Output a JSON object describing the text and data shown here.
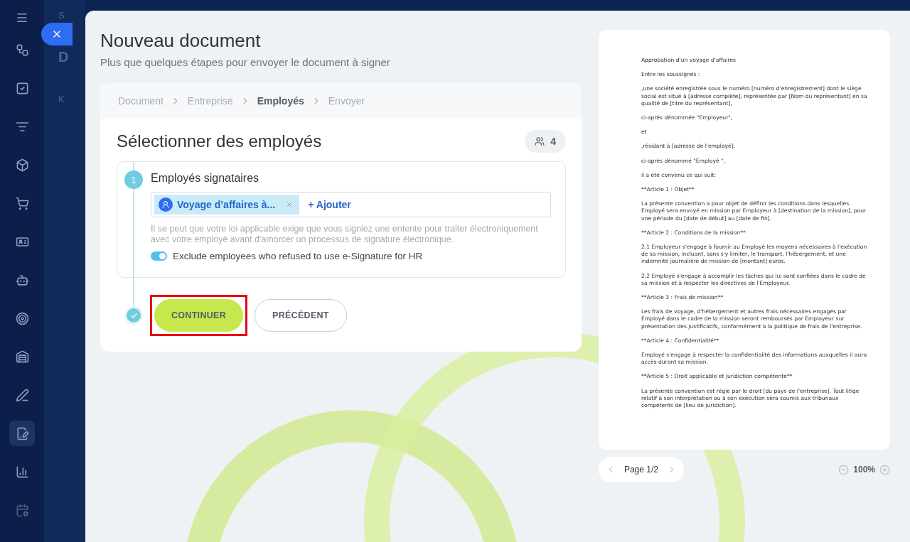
{
  "background": {
    "search_fragment": "S",
    "title_fragment": "D",
    "button_fragment": "K"
  },
  "modal": {
    "title": "Nouveau document",
    "subtitle": "Plus que quelques étapes pour envoyer le document à signer"
  },
  "breadcrumb": [
    {
      "label": "Document",
      "selected": false
    },
    {
      "label": "Entreprise",
      "selected": false
    },
    {
      "label": "Employés",
      "selected": true
    },
    {
      "label": "Envoyer",
      "selected": false
    }
  ],
  "section": {
    "title": "Sélectionner des employés",
    "count": "4"
  },
  "step": {
    "number": "1",
    "title": "Employés signataires",
    "tag": "Voyage d’affaires à...",
    "add_link": "+ Ajouter",
    "hint": "Il se peut que votre loi applicable exige que vous signiez une entente pour traiter électroniquement avec votre employé avant d'amorcer un processus de signature électronique.",
    "toggle": {
      "label": "Exclude employees who refused to use e-Signature for HR",
      "on": true
    }
  },
  "buttons": [
    {
      "label": "CONTINUER",
      "kind": "primary",
      "highlighted": true
    },
    {
      "label": "PRÉCÉDENT",
      "kind": "secondary",
      "highlighted": false
    }
  ],
  "document": {
    "paragraphs": [
      "Approbation d'un voyage d'affaires",
      "Entre les soussignés :",
      " ,une société enregistrée sous le numéro [numéro d'enregistrement] dont le siège social est situé à [adresse complète], représentée par [Nom du représentant] en sa qualité de [titre du représentant],",
      "ci-après dénommée \"Employeur\",",
      "et",
      " ,résidant à [adresse de l'employé],",
      "ci-après dénommé \"Employé \",",
      "il a été convenu ce qui suit:",
      "**Article 1 : Objet**",
      "La présente convention a pour objet de définir les conditions dans lesquelles Employé sera envoyé en mission par Employeur à [destination de la mission], pour une période du [date de début] au [date de fin].",
      "**Article 2 : Conditions de la mission**",
      "2.1 Employeur s'engage à fournir au Employé les moyens nécessaires à l'exécution de sa mission, incluant, sans s'y limiter, le transport, l'hébergement, et une indemnité journalière de mission de [montant] euros.",
      "2.2 Employé s'engage à accomplir les tâches qui lui sont confiées dans le cadre de sa mission et à respecter les directives de l'Employeur.",
      "**Article 3 : Frais de mission**",
      "Les frais de voyage, d'hébergement et autres frais nécessaires engagés par Employé dans le cadre de la mission seront remboursés par Employeur sur présentation des justificatifs, conformément à la politique de frais de l'entreprise.",
      "**Article 4 : Confidentialité**",
      "Employé s'engage à respecter la confidentialité des informations auxquelles il aura accès durant sa mission.",
      "**Article 5 : Droit applicable et juridiction compétente**",
      "La présente convention est régie par le droit [du pays de l'entreprise]. Tout litige relatif à son interprétation ou à son exécution sera soumis aux tribunaux compétents de [lieu de juridiction]."
    ],
    "pager": "Page 1/2",
    "zoom": "100%"
  }
}
